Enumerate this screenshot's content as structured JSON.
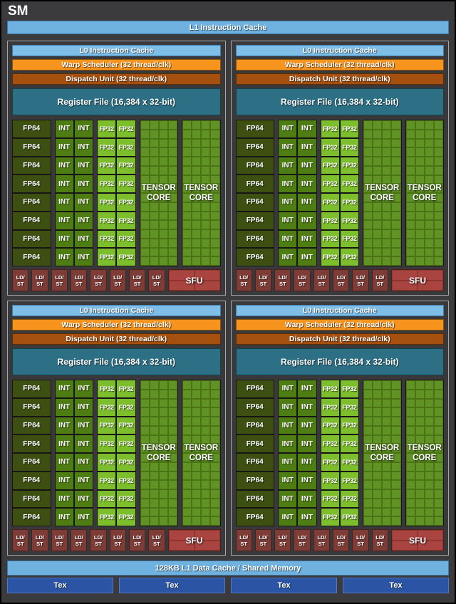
{
  "header": {
    "title": "SM",
    "l1_instruction_cache": "L1 Instruction Cache"
  },
  "partition": {
    "count": 4,
    "l0_label": "L0 Instruction Cache",
    "warp_label": "Warp Scheduler (32 thread/clk)",
    "dispatch_label": "Dispatch Unit (32 thread/clk)",
    "regfile_label": "Register File (16,384 x 32-bit)",
    "fp64_label": "FP64",
    "int_label": "INT",
    "fp32_label": "FP32",
    "tensor_line1": "TENSOR",
    "tensor_line2": "CORE",
    "ldst_line1": "LD/",
    "ldst_line2": "ST",
    "sfu_label": "SFU",
    "rows": 8,
    "fp64_count": 8,
    "int_count": 16,
    "fp32_count": 16,
    "tensor_block_count": 2,
    "tensor_grid_cols": 4,
    "tensor_grid_rows": 16,
    "ldst_count": 8
  },
  "footer": {
    "l1_data_cache": "128KB L1 Data Cache / Shared Memory",
    "tex_labels": [
      "Tex",
      "Tex",
      "Tex",
      "Tex"
    ]
  },
  "colors": {
    "page_bg": "#3B3B3D",
    "panel_bg": "#39393B",
    "panel_border": "#A8A8A8",
    "light_blue": "#6FB2DF",
    "l0_blue": "#7FBEE7",
    "blue_border": "#3A7CB0",
    "warp_orange": "#F7941E",
    "dispatch_rust": "#A6500F",
    "regfile_teal": "#2D6F85",
    "fp64_green": "#3D5011",
    "int_green": "#4E7D14",
    "fp32_green": "#7CBE2B",
    "tensor_green": "#609226",
    "tensor_line_green": "#4A7413",
    "ldst_red": "#7E3C37",
    "sfu_red": "#A94440",
    "sfu_line_red": "#8C3531",
    "tex_blue": "#2B55A4",
    "tex_border_blue": "#4D79C7",
    "text": "#FFFFFF"
  }
}
